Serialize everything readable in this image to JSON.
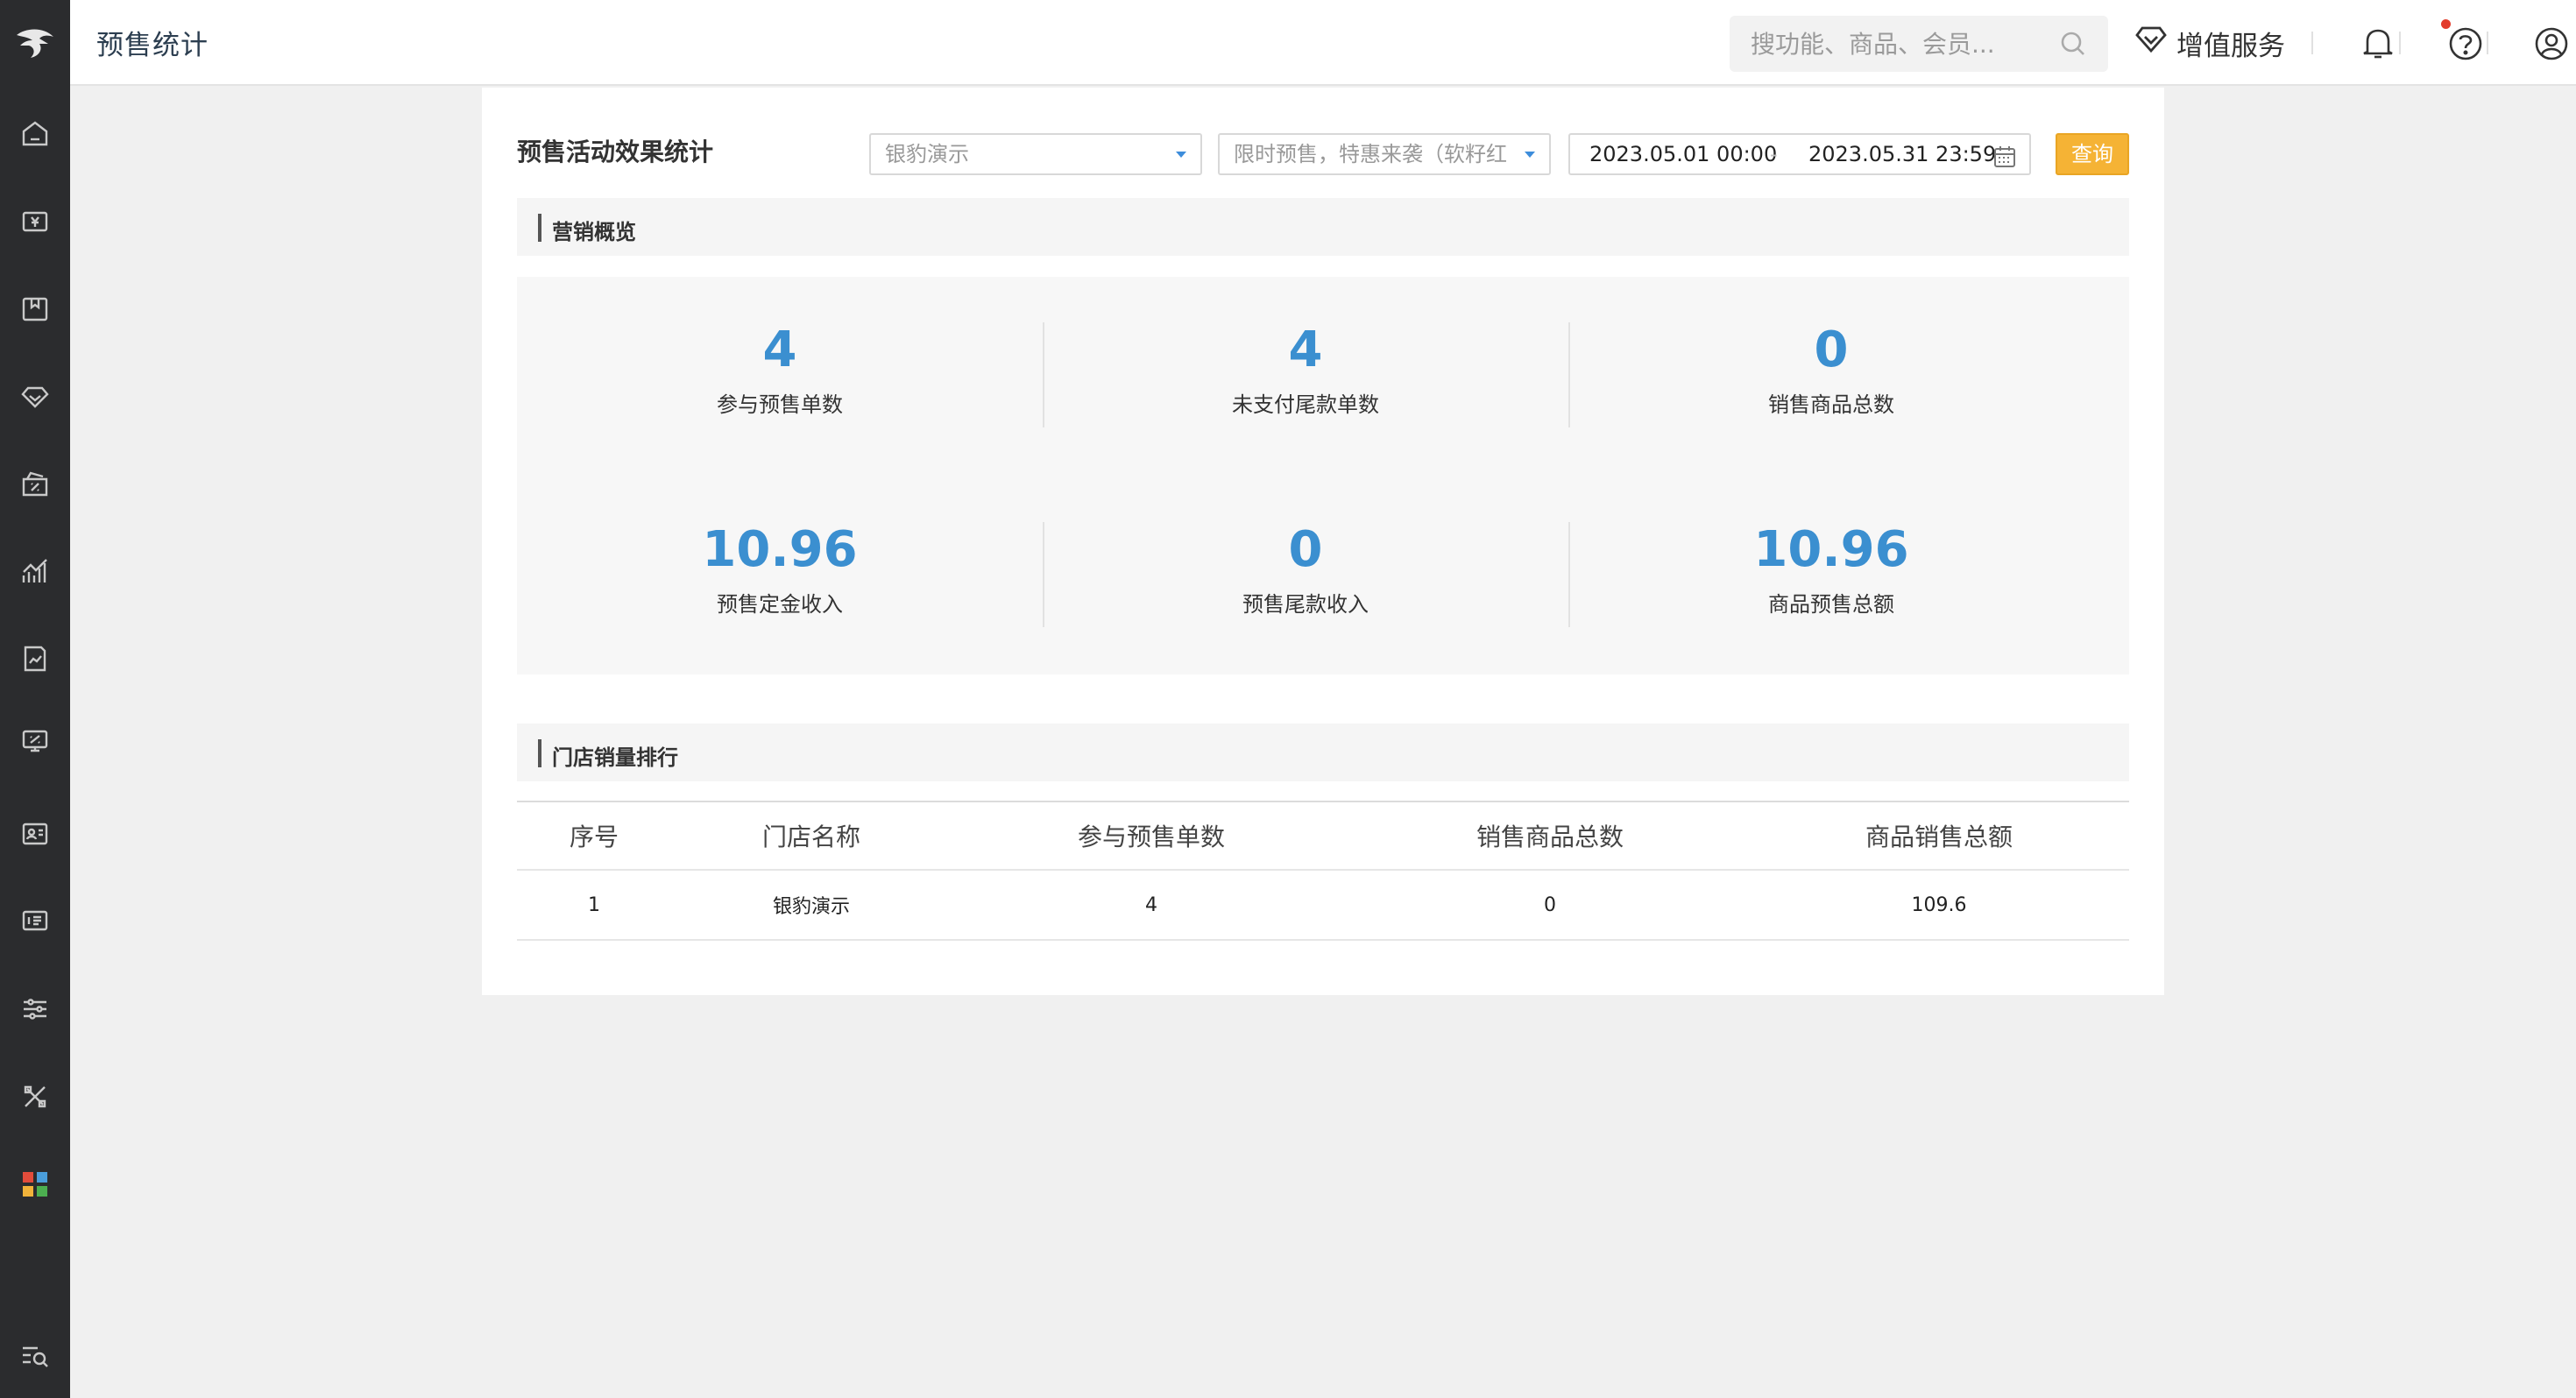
{
  "header": {
    "title": "预售统计",
    "search_placeholder": "搜功能、商品、会员...",
    "value_added_label": "增值服务"
  },
  "sidebar": {
    "icons": [
      "home-icon",
      "cashier-icon",
      "goods-icon",
      "member-diamond-icon",
      "coupon-icon",
      "analytics-icon",
      "report-icon",
      "finance-icon",
      "staff-icon",
      "message-icon",
      "settings-icon",
      "tools-icon",
      "apps-icon",
      "search-menu-icon"
    ]
  },
  "filters": {
    "card_title": "预售活动效果统计",
    "store_select": "银豹演示",
    "activity_select": "限时预售，特惠来袭（软籽红",
    "date_start": "2023.05.01 00:00",
    "date_sep": "-",
    "date_end": "2023.05.31 23:59",
    "query_label": "查询"
  },
  "overview": {
    "title": "营销概览",
    "stats": [
      {
        "value": "4",
        "label": "参与预售单数"
      },
      {
        "value": "4",
        "label": "未支付尾款单数"
      },
      {
        "value": "0",
        "label": "销售商品总数"
      },
      {
        "value": "10.96",
        "label": "预售定金收入"
      },
      {
        "value": "0",
        "label": "预售尾款收入"
      },
      {
        "value": "10.96",
        "label": "商品预售总额"
      }
    ]
  },
  "ranking": {
    "title": "门店销量排行",
    "columns": [
      "序号",
      "门店名称",
      "参与预售单数",
      "销售商品总数",
      "商品销售总额"
    ],
    "rows": [
      [
        "1",
        "银豹演示",
        "4",
        "0",
        "109.6"
      ]
    ]
  },
  "colors": {
    "accent": "#3b8fd0",
    "query_button": "#f5b335",
    "sidebar_bg": "#2b2c2e"
  }
}
